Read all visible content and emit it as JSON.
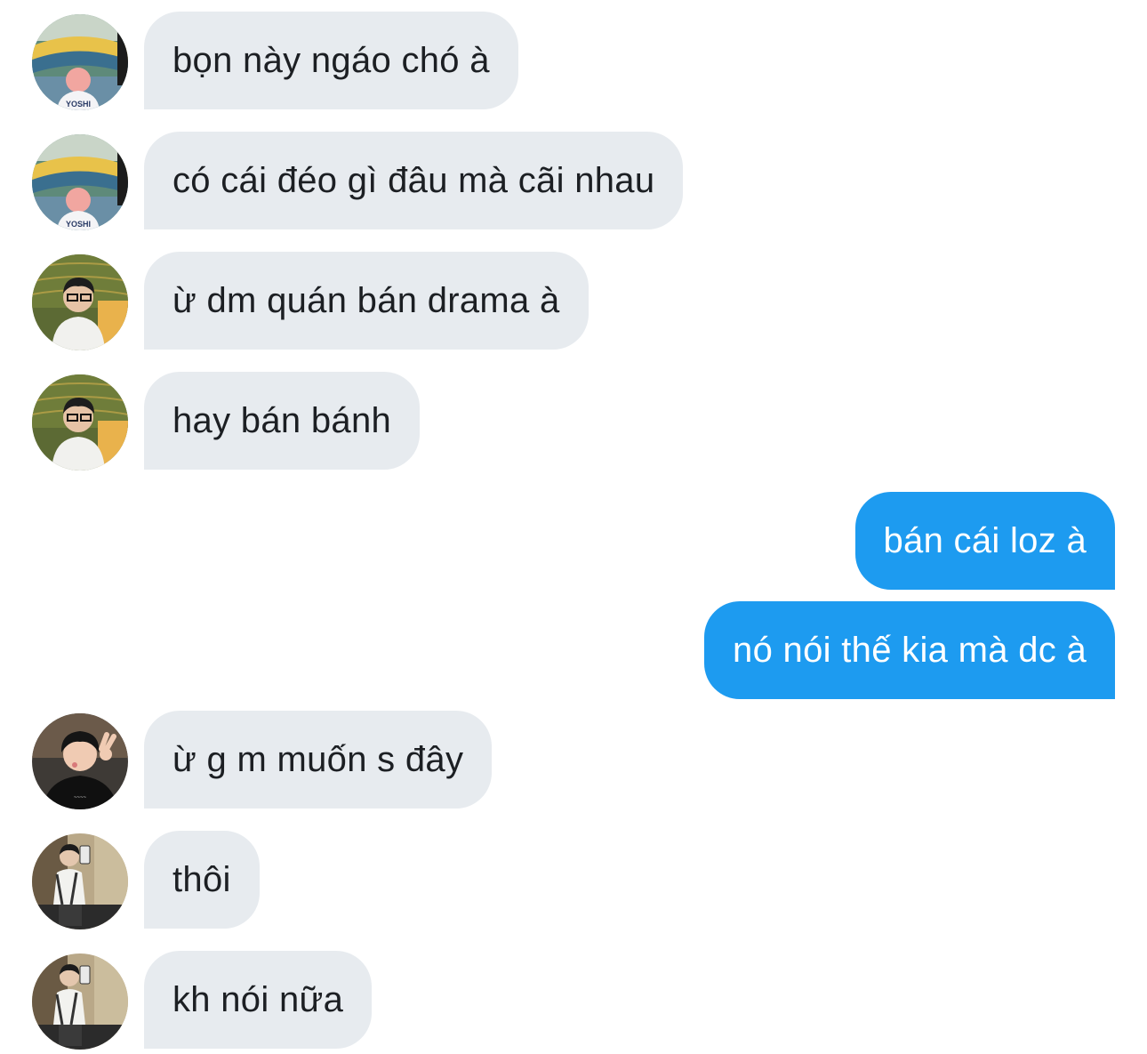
{
  "conversation": {
    "messages": [
      {
        "direction": "incoming",
        "avatar": "avatar-stadium-pink-hair",
        "text": "bọn này ngáo chó à"
      },
      {
        "direction": "incoming",
        "avatar": "avatar-stadium-pink-hair",
        "text": "có cái đéo gì đâu mà cãi nhau"
      },
      {
        "direction": "incoming",
        "avatar": "avatar-glasses-boy",
        "text": "ừ dm quán bán drama à"
      },
      {
        "direction": "incoming",
        "avatar": "avatar-glasses-boy",
        "text": "hay bán bánh"
      },
      {
        "direction": "outgoing",
        "text": "bán cái loz à"
      },
      {
        "direction": "outgoing",
        "text": "nó nói thế kia mà dc à"
      },
      {
        "direction": "incoming",
        "avatar": "avatar-peace-sign",
        "text": "ừ g m muốn s đây"
      },
      {
        "direction": "incoming",
        "avatar": "avatar-mirror-selfie",
        "text": "thôi"
      },
      {
        "direction": "incoming",
        "avatar": "avatar-mirror-selfie",
        "text": "kh nói nữa"
      }
    ]
  },
  "colors": {
    "incoming_bubble": "#e7ebef",
    "incoming_text": "#1c1f23",
    "outgoing_bubble": "#1d9bf0",
    "outgoing_text": "#ffffff",
    "background": "#ffffff"
  }
}
